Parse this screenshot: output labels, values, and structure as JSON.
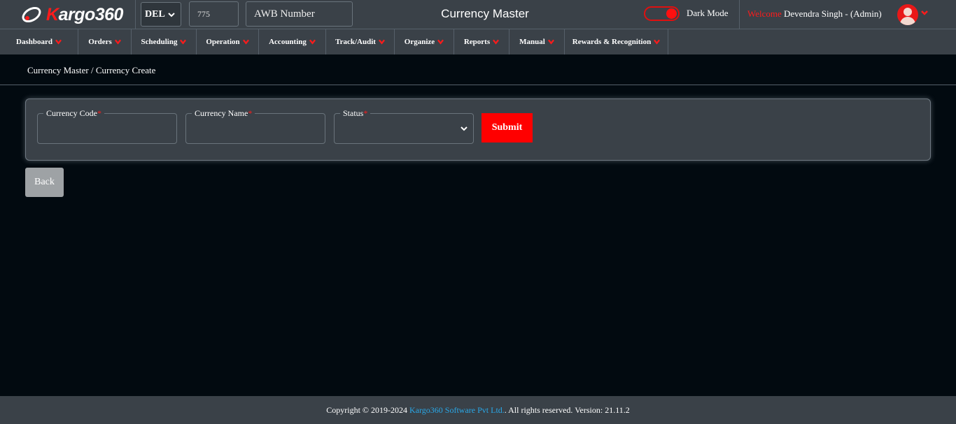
{
  "header": {
    "logo_text": "Kargo360",
    "station": "DEL",
    "awb_prefix": "775",
    "awb_placeholder": "AWB Number",
    "page_title": "Currency Master",
    "dark_mode_label": "Dark Mode",
    "welcome_label": "Welcome",
    "user_name": "Devendra Singh - (Admin)"
  },
  "nav": {
    "items": [
      {
        "label": "Dashboard"
      },
      {
        "label": "Orders"
      },
      {
        "label": "Scheduling"
      },
      {
        "label": "Operation"
      },
      {
        "label": "Accounting"
      },
      {
        "label": "Track/Audit"
      },
      {
        "label": "Organize"
      },
      {
        "label": "Reports"
      },
      {
        "label": "Manual"
      },
      {
        "label": "Rewards & Recognition"
      }
    ]
  },
  "breadcrumb": "Currency Master / Currency Create",
  "form": {
    "currency_code_label": "Currency Code",
    "currency_name_label": "Currency Name",
    "status_label": "Status",
    "required_mark": "*",
    "submit_label": "Submit"
  },
  "back_label": "Back",
  "footer": {
    "prefix": "Copyright © 2019-2024 ",
    "company": "Kargo360 Software Pvt Ltd.",
    "suffix": ". All rights reserved. Version: 21.11.2"
  },
  "colors": {
    "accent": "#ff0000",
    "link": "#29a8e8",
    "panel": "#3a4148",
    "background": "#020a10"
  }
}
